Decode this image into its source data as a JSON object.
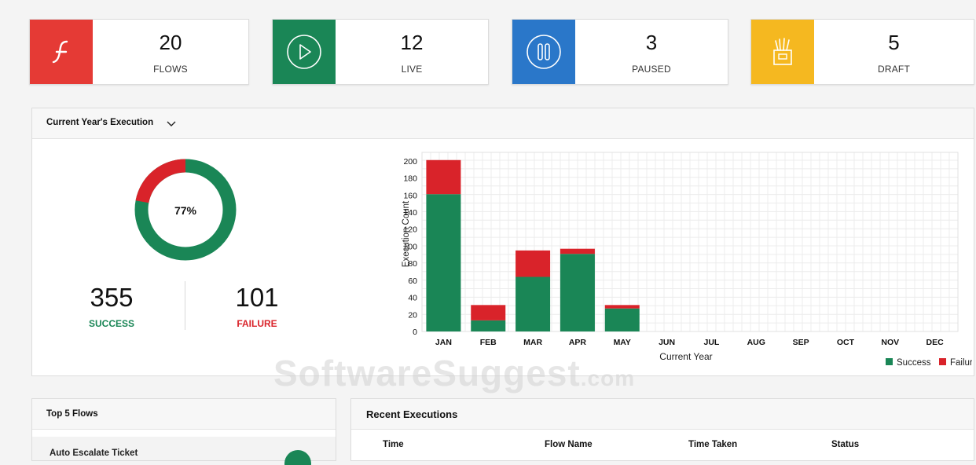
{
  "stats": [
    {
      "value": "20",
      "label": "FLOWS",
      "color": "#e53a35",
      "icon": "flash-icon"
    },
    {
      "value": "12",
      "label": "LIVE",
      "color": "#1a8656",
      "icon": "play-icon"
    },
    {
      "value": "3",
      "label": "PAUSED",
      "color": "#2a77c9",
      "icon": "pause-icon"
    },
    {
      "value": "5",
      "label": "DRAFT",
      "color": "#f5b820",
      "icon": "draft-icon"
    }
  ],
  "execution": {
    "title": "Current Year's Execution",
    "percent_label": "77%",
    "success_count": "355",
    "success_label": "SUCCESS",
    "failure_count": "101",
    "failure_label": "FAILURE",
    "success_color": "#1a8656",
    "failure_color": "#d9232a"
  },
  "chart_data": {
    "type": "bar",
    "stacked": true,
    "categories": [
      "JAN",
      "FEB",
      "MAR",
      "APR",
      "MAY",
      "JUN",
      "JUL",
      "AUG",
      "SEP",
      "OCT",
      "NOV",
      "DEC"
    ],
    "series": [
      {
        "name": "Success",
        "color": "#1a8656",
        "values": [
          161,
          13,
          64,
          91,
          27,
          0,
          0,
          0,
          0,
          0,
          0,
          0
        ]
      },
      {
        "name": "Failure",
        "color": "#d9232a",
        "values": [
          40,
          18,
          31,
          6,
          4,
          0,
          0,
          0,
          0,
          0,
          0,
          0
        ]
      }
    ],
    "xlabel": "Current Year",
    "ylabel": "Execution Count",
    "ylim": [
      0,
      210
    ],
    "yticks": [
      0,
      20,
      40,
      60,
      80,
      100,
      120,
      140,
      160,
      180,
      200
    ],
    "grid": true,
    "legend": "bottom-right"
  },
  "watermark": {
    "main": "SoftwareSuggest",
    "suffix": ".com"
  },
  "top_flows": {
    "title": "Top 5 Flows",
    "items": [
      "Auto Escalate Ticket"
    ]
  },
  "recent": {
    "title": "Recent Executions",
    "columns": [
      "Time",
      "Flow Name",
      "Time Taken",
      "Status"
    ]
  }
}
